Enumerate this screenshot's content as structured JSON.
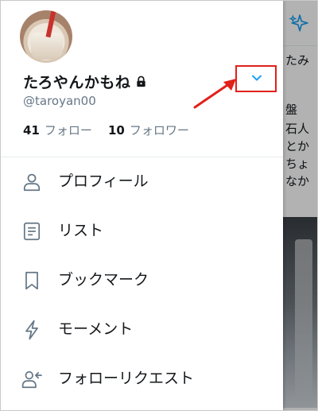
{
  "profile": {
    "display_name": "たろやんかもね",
    "handle": "@taroyan00",
    "following_count": "41",
    "following_label": "フォロー",
    "followers_count": "10",
    "followers_label": "フォロワー"
  },
  "menu": {
    "items": [
      {
        "label": "プロフィール",
        "icon": "person-icon"
      },
      {
        "label": "リスト",
        "icon": "list-icon"
      },
      {
        "label": "ブックマーク",
        "icon": "bookmark-icon"
      },
      {
        "label": "モーメント",
        "icon": "lightning-icon"
      },
      {
        "label": "フォローリクエスト",
        "icon": "follow-request-icon"
      }
    ]
  },
  "background_timeline": {
    "snippets": [
      "たみ",
      "盤",
      "石人",
      "とか",
      "ちょ",
      "なか"
    ]
  },
  "colors": {
    "accent": "#1da1f2",
    "annotation_red": "#e0211a",
    "text_primary": "#14171a",
    "text_secondary": "#657786"
  }
}
